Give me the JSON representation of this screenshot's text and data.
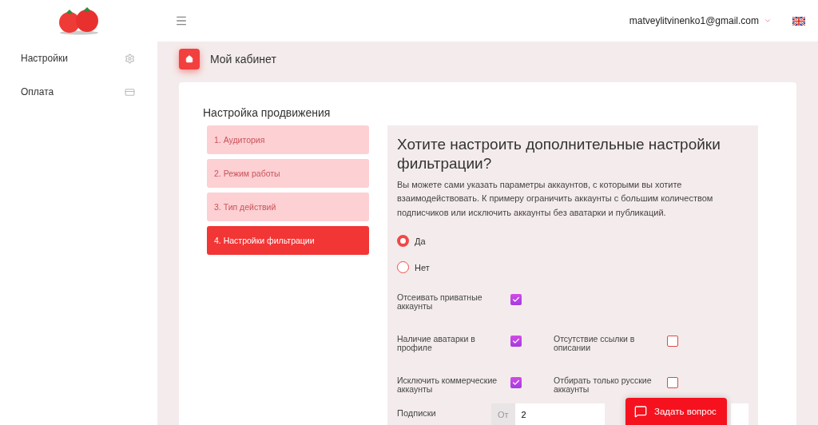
{
  "header": {
    "email": "matveylitvinenko1@gmail.com"
  },
  "sidebar": {
    "items": [
      {
        "label": "Настройки"
      },
      {
        "label": "Оплата"
      }
    ]
  },
  "breadcrumb": {
    "title": "Мой кабинет"
  },
  "card": {
    "title": "Настройка продвижения",
    "steps": [
      {
        "label": "1. Аудитория",
        "selected": false
      },
      {
        "label": "2. Режим работы",
        "selected": false
      },
      {
        "label": "3. Тип действий",
        "selected": false
      },
      {
        "label": "4. Настройки фильтрации",
        "selected": true
      }
    ],
    "panel": {
      "heading": "Хотите настроить дополнительные настройки фильтрации?",
      "description": "Вы можете сами указать параметры аккаунтов, с которыми вы хотите взаимодействовать. К примеру ограничить аккаунты с большим количеством подписчиков или исключить аккаунты без аватарки и публикаций.",
      "options": [
        {
          "label": "Да",
          "selected": true
        },
        {
          "label": "Нет",
          "selected": false
        }
      ],
      "filter_rows": [
        [
          {
            "label": "Отсеивать приватные аккаунты",
            "checked": true
          }
        ],
        [
          {
            "label": "Наличие аватарки в профиле",
            "checked": true
          },
          {
            "label": "Отсутствие ссылки в описании",
            "checked": false
          }
        ],
        [
          {
            "label": "Исключить коммерческие аккаунты",
            "checked": true
          },
          {
            "label": "Отбирать только русские аккаунты",
            "checked": false
          }
        ]
      ],
      "range": {
        "label": "Подписки",
        "prefix": "От",
        "value": "2"
      }
    }
  },
  "chat_button": {
    "label": "Задать вопрос"
  }
}
